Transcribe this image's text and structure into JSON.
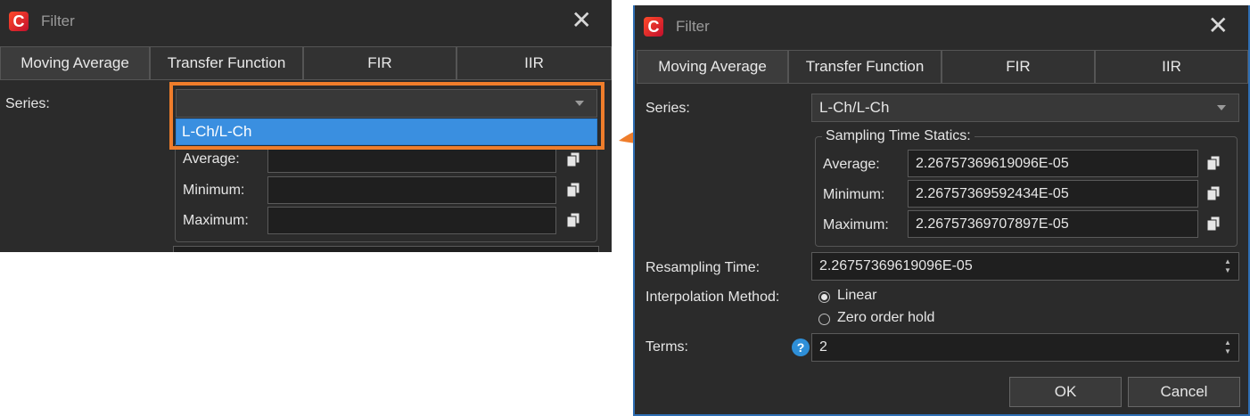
{
  "window1": {
    "title": "Filter",
    "close_glyph": "✕",
    "tabs": [
      {
        "label": "Moving Average"
      },
      {
        "label": "Transfer Function"
      },
      {
        "label": "FIR"
      },
      {
        "label": "IIR"
      }
    ],
    "series_label": "Series:",
    "series_value": "",
    "dropdown_options": [
      "L-Ch/L-Ch"
    ],
    "stats": {
      "average_label": "Average:",
      "minimum_label": "Minimum:",
      "maximum_label": "Maximum:",
      "average_value": "",
      "minimum_value": "",
      "maximum_value": ""
    }
  },
  "window2": {
    "title": "Filter",
    "close_glyph": "✕",
    "tabs": [
      {
        "label": "Moving Average"
      },
      {
        "label": "Transfer Function"
      },
      {
        "label": "FIR"
      },
      {
        "label": "IIR"
      }
    ],
    "series_label": "Series:",
    "series_value": "L-Ch/L-Ch",
    "sampling_group_title": "Sampling Time Statics:",
    "stats": {
      "average_label": "Average:",
      "minimum_label": "Minimum:",
      "maximum_label": "Maximum:",
      "average_value": "2.26757369619096E-05",
      "minimum_value": "2.26757369592434E-05",
      "maximum_value": "2.26757369707897E-05"
    },
    "resampling_label": "Resampling Time:",
    "resampling_value": "2.26757369619096E-05",
    "interpolation_label": "Interpolation Method:",
    "interp_options": [
      "Linear",
      "Zero order hold"
    ],
    "interp_selected": "Linear",
    "terms_label": "Terms:",
    "terms_value": "2",
    "ok_label": "OK",
    "cancel_label": "Cancel"
  },
  "colors": {
    "highlight": "#ef7d2b",
    "arrow": "#ef7d2b",
    "selection": "#3a8fe0",
    "window_bg": "#2b2b2b",
    "help_icon": "#2e8fd8"
  },
  "app_icon_letter": "C"
}
